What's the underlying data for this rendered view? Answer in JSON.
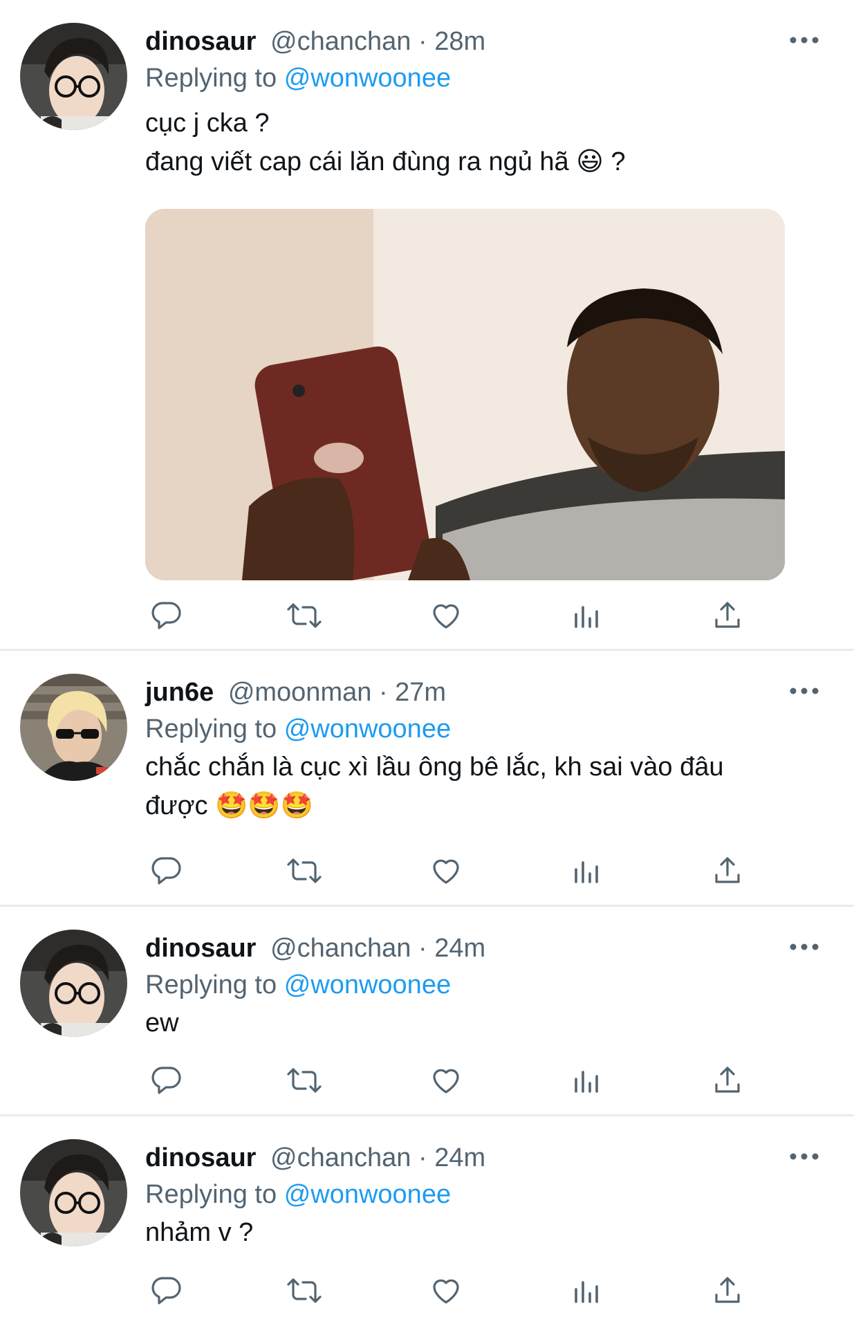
{
  "tweets": [
    {
      "name": "dinosaur",
      "handle": "@chanchan",
      "time": "28m",
      "replying_label": "Replying to",
      "replying_to": "@wonwoonee",
      "text_lines": [
        "cục j cka ?",
        "đang viết cap cái lăn đùng ra ngủ hã 😃 ?"
      ],
      "avatar": "avatar-glasses",
      "has_media": true
    },
    {
      "name": "jun6e",
      "handle": "@moonman",
      "time": "27m",
      "replying_label": "Replying to",
      "replying_to": "@wonwoonee",
      "text_lines": [
        "chắc chắn là cục xì lầu ông bê lắc, kh sai vào đâu",
        "được 🤩🤩🤩"
      ],
      "avatar": "avatar-blond",
      "has_media": false
    },
    {
      "name": "dinosaur",
      "handle": "@chanchan",
      "time": "24m",
      "replying_label": "Replying to",
      "replying_to": "@wonwoonee",
      "text_lines": [
        "ew"
      ],
      "avatar": "avatar-glasses",
      "has_media": false
    },
    {
      "name": "dinosaur",
      "handle": "@chanchan",
      "time": "24m",
      "replying_label": "Replying to",
      "replying_to": "@wonwoonee",
      "text_lines": [
        "nhảm v ?"
      ],
      "avatar": "avatar-glasses",
      "has_media": false
    }
  ],
  "icons": {
    "reply": "reply-icon",
    "retweet": "retweet-icon",
    "like": "heart-icon",
    "views": "views-icon",
    "share": "share-icon",
    "more": "more-icon"
  },
  "colors": {
    "text": "#0f1419",
    "secondary": "#536471",
    "mention": "#1d9bf0",
    "icon": "#536471",
    "divider": "#e9ecef"
  }
}
